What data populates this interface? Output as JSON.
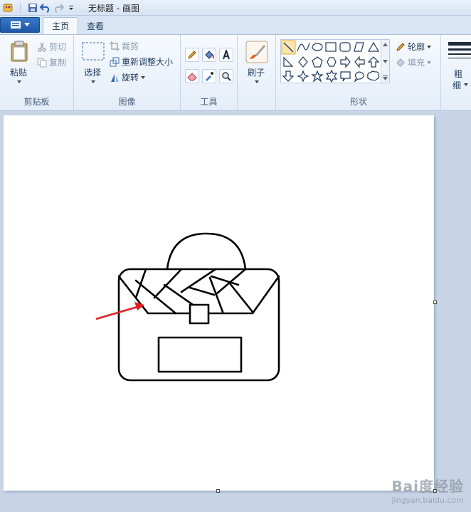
{
  "window": {
    "title": "无标题 - 画图"
  },
  "quick_access": [
    "app-icon",
    "save-icon",
    "undo-icon",
    "redo-icon",
    "customize-dropdown-icon"
  ],
  "tabs": [
    {
      "label": "主页",
      "active": true
    },
    {
      "label": "查看",
      "active": false
    }
  ],
  "ribbon": {
    "clipboard": {
      "label": "剪贴板",
      "paste": "粘贴",
      "cut": "剪切",
      "copy": "复制"
    },
    "image": {
      "label": "图像",
      "select": "选择",
      "crop": "裁剪",
      "resize": "重新调整大小",
      "rotate": "旋转"
    },
    "tools": {
      "label": "工具"
    },
    "brushes": {
      "label": "刷子"
    },
    "shapes": {
      "label": "形状",
      "outline": "轮廓",
      "fill": "填充"
    },
    "size": {
      "label_line1": "粗",
      "label_line2": "细"
    }
  },
  "watermark": {
    "logo": "Bai度经验",
    "url": "jingyan.baidu.com"
  },
  "colors": {
    "accent": "#1d58a8",
    "arrow": "#e02020",
    "ribbon_bg": "#e4edf8",
    "workspace": "#c7d4e6"
  }
}
